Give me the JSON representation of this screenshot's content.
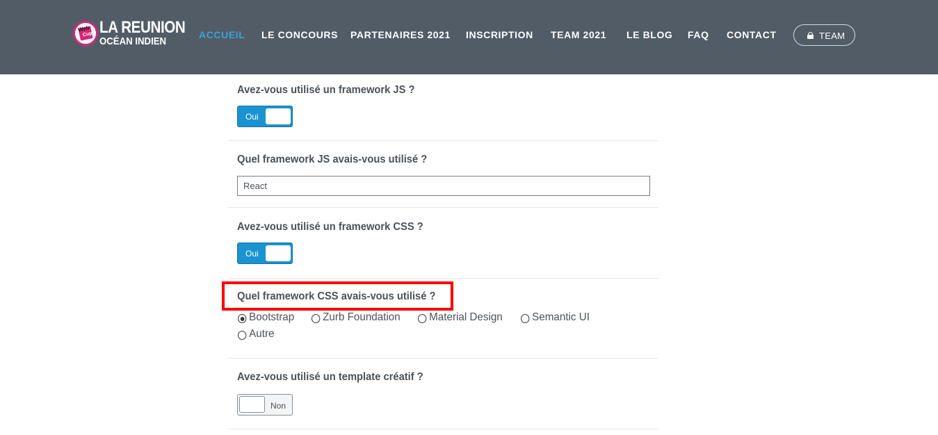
{
  "brand": {
    "badge_line1": "Web",
    "badge_line2": "Cup",
    "title": "LA REUNION",
    "subtitle": "OCÉAN INDIEN"
  },
  "nav": {
    "items": [
      {
        "label": "ACCUEIL",
        "active": true
      },
      {
        "label": "LE CONCOURS"
      },
      {
        "label": "PARTENAIRES 2021"
      },
      {
        "label": "INSCRIPTION"
      },
      {
        "label": "TEAM 2021"
      },
      {
        "label": "LE BLOG"
      },
      {
        "label": "FAQ"
      },
      {
        "label": "CONTACT"
      }
    ],
    "team_button": {
      "label": "TEAM",
      "icon": "lock-icon"
    }
  },
  "form": {
    "q_js_used": {
      "label": "Avez-vous utilisé un framework JS ?",
      "toggle": "Oui"
    },
    "q_js_which": {
      "label": "Quel framework JS avais-vous utilisé ?",
      "value": "React"
    },
    "q_css_used": {
      "label": "Avez-vous utilisé un framework CSS ?",
      "toggle": "Oui"
    },
    "q_css_which": {
      "label": "Quel framework CSS avais-vous utilisé ?",
      "options": [
        "Bootstrap",
        "Zurb Foundation",
        "Material Design",
        "Semantic UI",
        "Autre"
      ],
      "selected": "Bootstrap"
    },
    "q_template": {
      "label": "Avez-vous utilisé un template créatif ?",
      "toggle": "Non"
    }
  },
  "colors": {
    "navbar": "#515c67",
    "accent": "#3aa3d8",
    "toggle_on": "#1a93d1",
    "highlight": "#ff0000"
  }
}
